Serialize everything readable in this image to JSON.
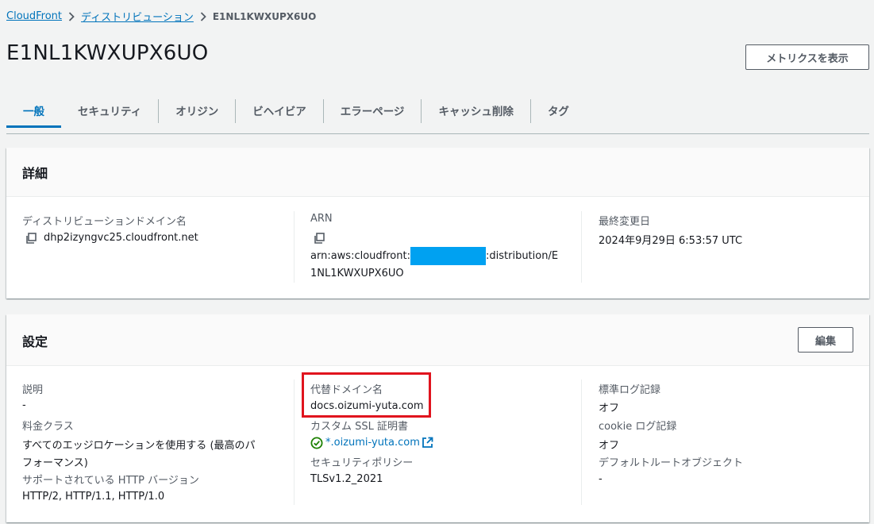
{
  "breadcrumb": {
    "items": [
      "CloudFront",
      "ディストリビューション"
    ],
    "current": "E1NL1KWXUPX6UO"
  },
  "page_title": "E1NL1KWXUPX6UO",
  "metrics_button": "メトリクスを表示",
  "tabs": [
    "一般",
    "セキュリティ",
    "オリジン",
    "ビヘイビア",
    "エラーページ",
    "キャッシュ削除",
    "タグ"
  ],
  "active_tab": "一般",
  "details": {
    "title": "詳細",
    "domain_label": "ディストリビューションドメイン名",
    "domain_value": "dhp2izyngvc25.cloudfront.net",
    "arn_label": "ARN",
    "arn_part1": "arn:aws:cloudfront::",
    "arn_part2": ":distribution/E",
    "arn_part3": "1NL1KWXUPX6UO",
    "modified_label": "最終変更日",
    "modified_value": "2024年9月29日 6:53:57 UTC"
  },
  "settings": {
    "title": "設定",
    "edit_button": "編集",
    "description_label": "説明",
    "description_value": "-",
    "price_class_label": "料金クラス",
    "price_class_value_line1": "すべてのエッジロケーションを使用する (最高のパ",
    "price_class_value_line2": "フォーマンス)",
    "http_label": "サポートされている HTTP バージョン",
    "http_value": "HTTP/2, HTTP/1.1, HTTP/1.0",
    "alt_domain_label": "代替ドメイン名",
    "alt_domain_value": "docs.oizumi-yuta.com",
    "ssl_label": "カスタム SSL 証明書",
    "ssl_value": "*.oizumi-yuta.com",
    "security_policy_label": "セキュリティポリシー",
    "security_policy_value": "TLSv1.2_2021",
    "std_log_label": "標準ログ記録",
    "std_log_value": "オフ",
    "cookie_log_label": "cookie ログ記録",
    "cookie_log_value": "オフ",
    "default_root_label": "デフォルトルートオブジェクト",
    "default_root_value": "-"
  },
  "colors": {
    "link": "#0073bb",
    "background": "#f2f3f3",
    "success": "#1d8102",
    "highlight": "#e0141e",
    "redaction": "#00a1f1"
  }
}
